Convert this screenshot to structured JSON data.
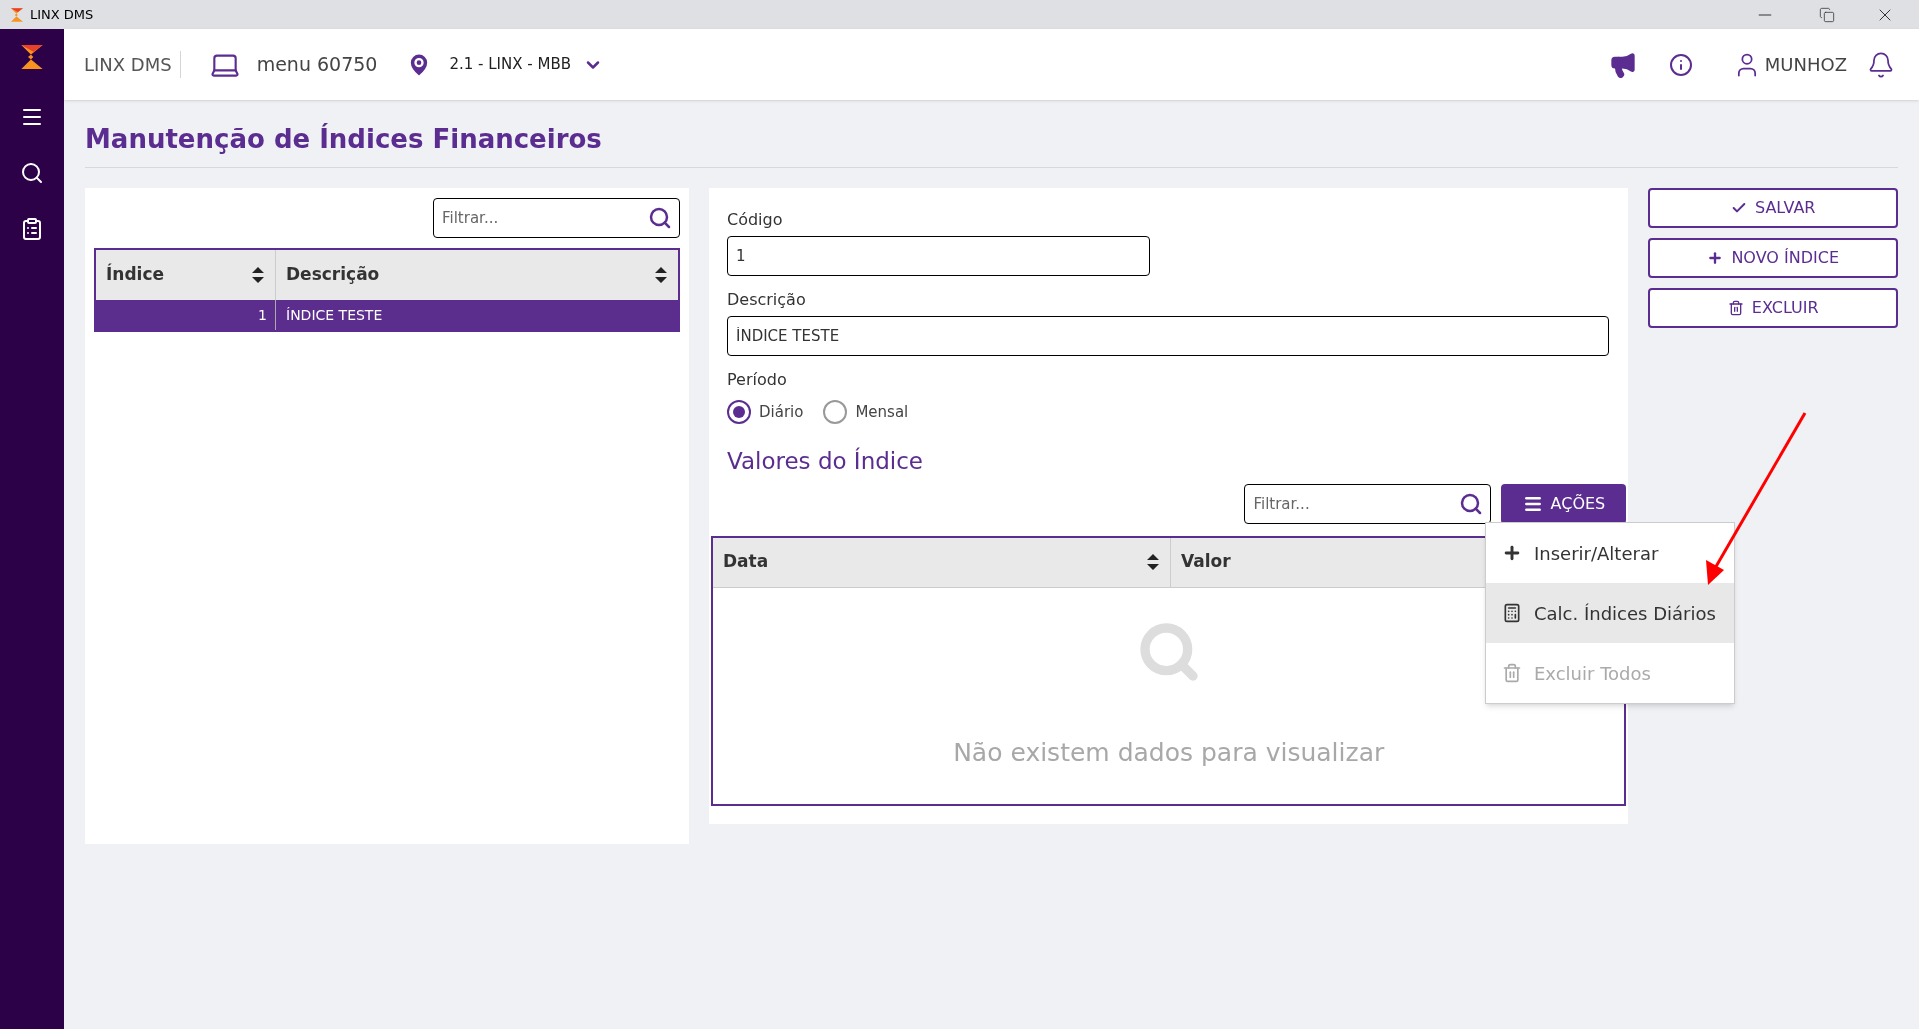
{
  "window": {
    "title": "LINX DMS"
  },
  "header": {
    "brand": "LINX DMS",
    "menu": "menu 60750",
    "location": "2.1 - LINX - MBB",
    "user": "MUNHOZ"
  },
  "page_title": "Manutenção de Índices Financeiros",
  "index_list": {
    "filter_placeholder": "Filtrar...",
    "columns": [
      "Índice",
      "Descrição"
    ],
    "rows": [
      {
        "index": "1",
        "description": "ÍNDICE TESTE",
        "selected": true
      }
    ]
  },
  "form": {
    "code_label": "Código",
    "code_value": "1",
    "description_label": "Descrição",
    "description_value": "ÍNDICE TESTE",
    "period_label": "Período",
    "period_options": [
      {
        "label": "Diário",
        "selected": true
      },
      {
        "label": "Mensal",
        "selected": false
      }
    ]
  },
  "values": {
    "title": "Valores do Índice",
    "filter_placeholder": "Filtrar...",
    "actions_button": "AÇÕES",
    "columns": [
      "Data",
      "Valor"
    ],
    "empty_text": "Não existem dados para visualizar"
  },
  "actions_menu": [
    {
      "kind": "plus",
      "label": "Inserir/Alterar",
      "selected": false,
      "disabled": false
    },
    {
      "kind": "calculator",
      "label": "Calc. Índices Diários",
      "selected": true,
      "disabled": false
    },
    {
      "kind": "trash",
      "label": "Excluir Todos",
      "selected": false,
      "disabled": true
    }
  ],
  "buttons": [
    {
      "kind": "check",
      "label": "SALVAR"
    },
    {
      "kind": "plus",
      "label": "NOVO ÍNDICE"
    },
    {
      "kind": "trash",
      "label": "EXCLUIR"
    }
  ]
}
